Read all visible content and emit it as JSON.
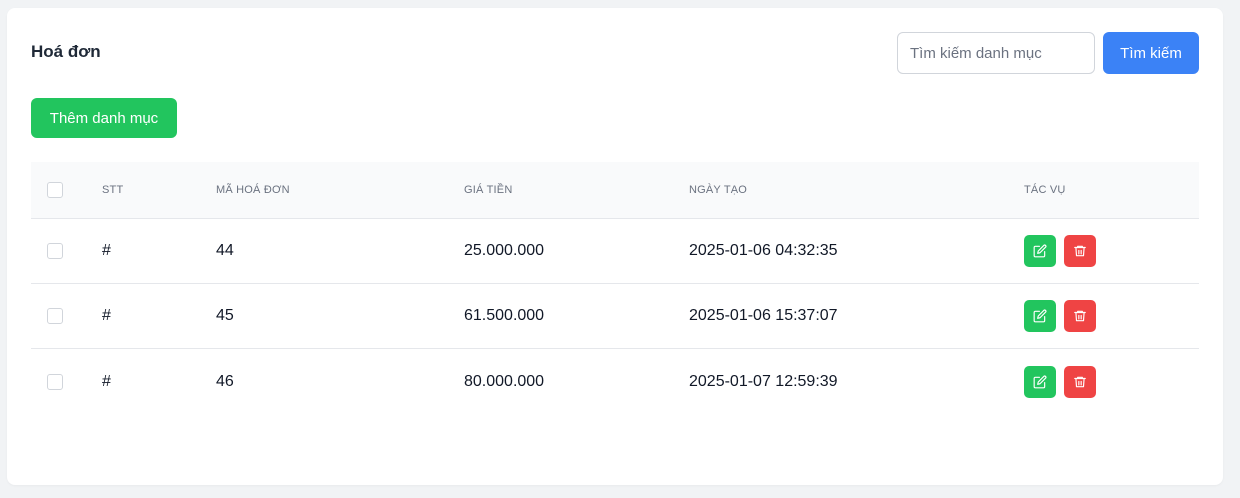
{
  "header": {
    "title": "Hoá đơn",
    "search_placeholder": "Tìm kiếm danh mục",
    "search_button": "Tìm kiếm",
    "add_button": "Thêm danh mục"
  },
  "table": {
    "columns": {
      "stt": "STT",
      "code": "MÃ HOÁ ĐƠN",
      "price": "GIÁ TIỀN",
      "date": "NGÀY TẠO",
      "actions": "TÁC VỤ"
    },
    "rows": [
      {
        "stt": "#",
        "code": "44",
        "price": "25.000.000",
        "date": "2025-01-06 04:32:35"
      },
      {
        "stt": "#",
        "code": "45",
        "price": "61.500.000",
        "date": "2025-01-06 15:37:07"
      },
      {
        "stt": "#",
        "code": "46",
        "price": "80.000.000",
        "date": "2025-01-07 12:59:39"
      }
    ]
  },
  "icons": {
    "edit": "edit-icon",
    "delete": "trash-icon"
  },
  "colors": {
    "primary": "#3b82f6",
    "success": "#22c55e",
    "danger": "#ef4444"
  }
}
